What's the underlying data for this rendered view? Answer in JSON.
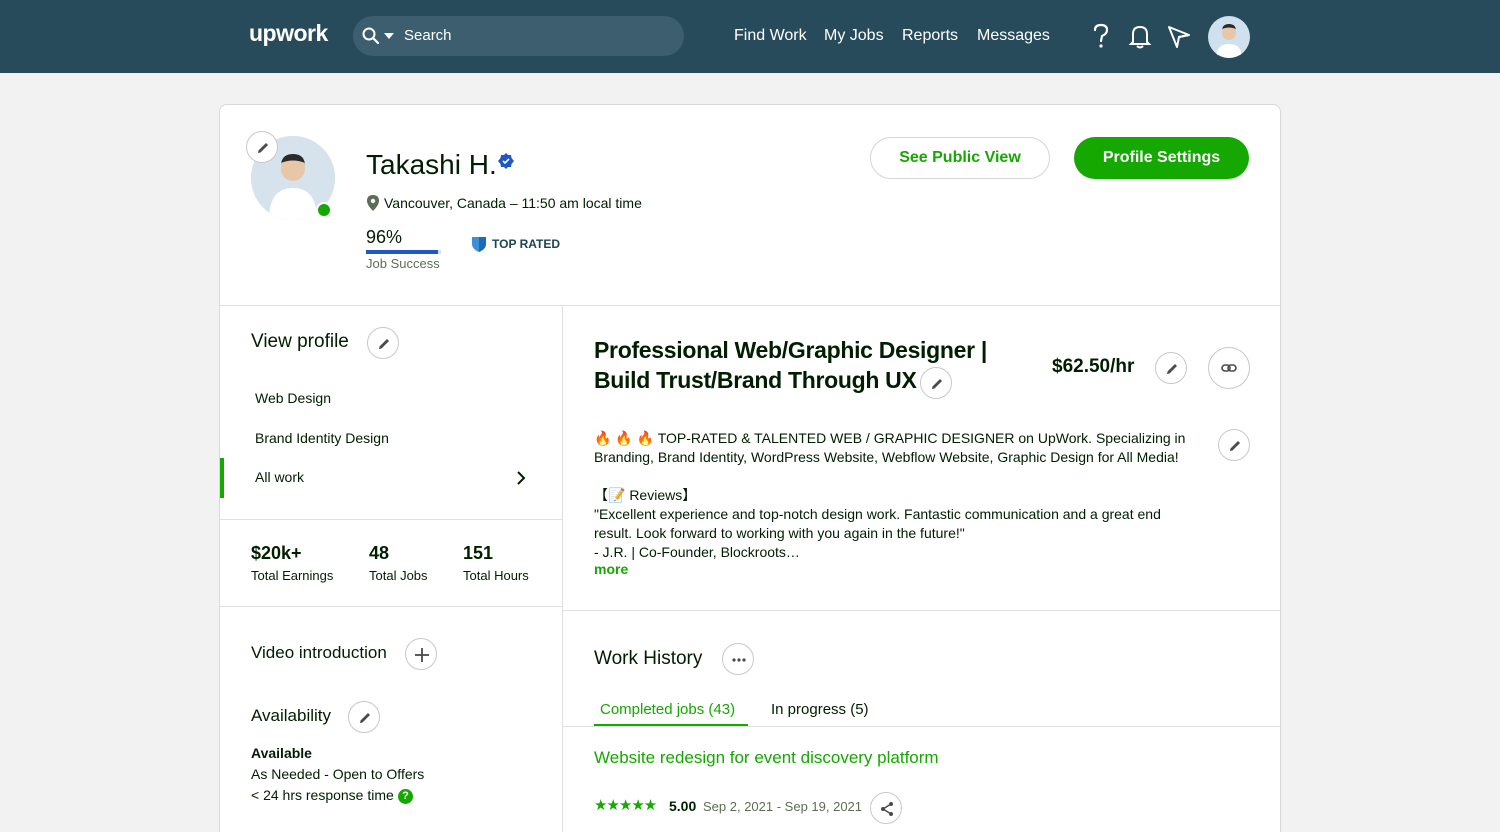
{
  "topbar": {
    "logo": "upwork",
    "search_placeholder": "Search",
    "nav": [
      "Find Work",
      "My Jobs",
      "Reports",
      "Messages"
    ]
  },
  "profile": {
    "name": "Takashi H.",
    "location": "Vancouver, Canada – 11:50 am local time",
    "job_success_value": "96%",
    "job_success_fraction": 0.96,
    "job_success_label": "Job Success",
    "badge": "TOP RATED",
    "see_public_view": "See Public View",
    "profile_settings": "Profile Settings"
  },
  "sidebar": {
    "view_profile": "View profile",
    "categories": [
      "Web Design",
      "Brand Identity Design",
      "All work"
    ],
    "stats": [
      {
        "value": "$20k+",
        "label": "Total Earnings"
      },
      {
        "value": "48",
        "label": "Total Jobs"
      },
      {
        "value": "151",
        "label": "Total Hours"
      }
    ],
    "video_intro": "Video introduction",
    "availability": "Availability",
    "availability_status": "Available",
    "availability_type": "As Needed - Open to Offers",
    "response_time": "< 24 hrs response time"
  },
  "main": {
    "title_line1": "Professional Web/Graphic Designer |",
    "title_line2": "Build Trust/Brand Through UX",
    "rate": "$62.50/hr",
    "bio": [
      "🔥 🔥 🔥 TOP-RATED & TALENTED WEB / GRAPHIC DESIGNER on UpWork. Specializing in",
      "Branding, Brand Identity, WordPress Website, Webflow Website, Graphic Design for All Media!",
      "",
      "【📝 Reviews】",
      "\"Excellent experience and top-notch design work. Fantastic communication and a great end",
      "result. Look forward to working with you again in the future!\"",
      "- J.R. | Co-Founder, Blockroots…"
    ],
    "more": "more",
    "work_history": "Work History",
    "tabs": [
      "Completed jobs (43)",
      "In progress (5)"
    ],
    "job": {
      "title": "Website redesign for event discovery platform",
      "stars": "★★★★★",
      "rating": "5.00",
      "dates": "Sep 2, 2021 - Sep 19, 2021"
    }
  },
  "colors": {
    "header_bg": "#284b5c",
    "accent_green": "#14a800",
    "verified_blue": "#1f57c3"
  }
}
